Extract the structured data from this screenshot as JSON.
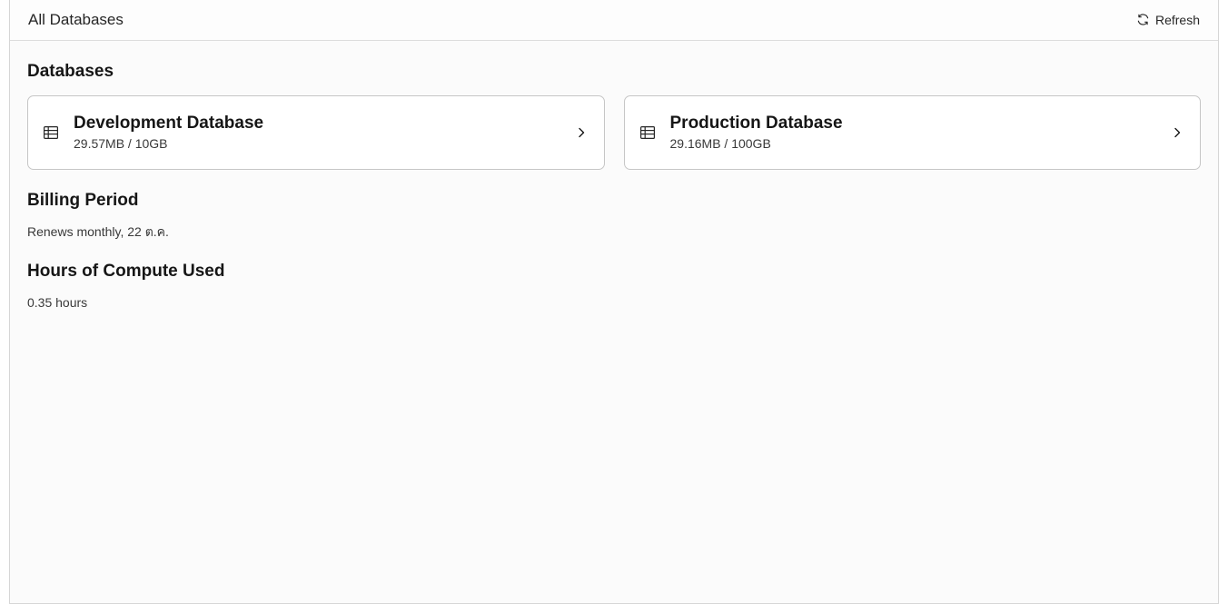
{
  "header": {
    "title": "All Databases",
    "refresh_label": "Refresh",
    "refresh_icon": "refresh-icon"
  },
  "databases_section": {
    "heading": "Databases",
    "items": [
      {
        "name": "Development Database",
        "usage": "29.57MB / 10GB",
        "icon": "table-icon"
      },
      {
        "name": "Production Database",
        "usage": "29.16MB / 100GB",
        "icon": "table-icon"
      }
    ]
  },
  "billing": {
    "heading": "Billing Period",
    "value": "Renews monthly, 22 ต.ค."
  },
  "compute": {
    "heading": "Hours of Compute Used",
    "value": "0.35 hours"
  }
}
